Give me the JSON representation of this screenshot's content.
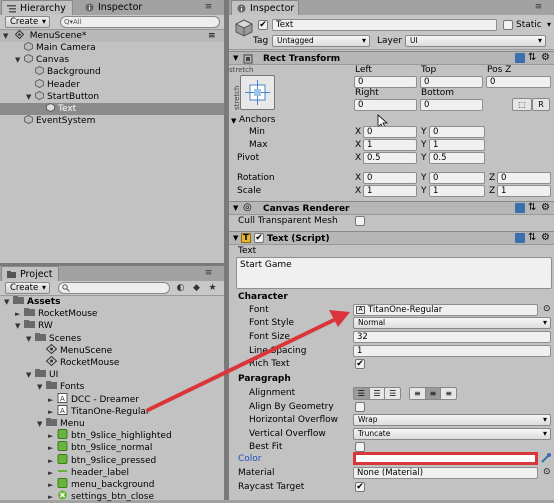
{
  "hierarchy": {
    "tabs": [
      "Hierarchy",
      "Inspector"
    ],
    "create_label": "Create",
    "search_prefix": "Q▾All",
    "scene_name": "MenuScene*",
    "items": [
      {
        "label": "Main Camera",
        "depth": 1,
        "arrow": ""
      },
      {
        "label": "Canvas",
        "depth": 1,
        "arrow": "▼"
      },
      {
        "label": "Background",
        "depth": 2,
        "arrow": ""
      },
      {
        "label": "Header",
        "depth": 2,
        "arrow": ""
      },
      {
        "label": "StartButton",
        "depth": 2,
        "arrow": "▼"
      },
      {
        "label": "Text",
        "depth": 3,
        "arrow": "",
        "selected": true
      },
      {
        "label": "EventSystem",
        "depth": 1,
        "arrow": ""
      }
    ]
  },
  "project": {
    "tab_label": "Project",
    "create_label": "Create",
    "items": [
      {
        "label": "Assets",
        "depth": 0,
        "arrow": "▼",
        "type": "folder",
        "bold": true
      },
      {
        "label": "RocketMouse",
        "depth": 1,
        "arrow": "►",
        "type": "folder"
      },
      {
        "label": "RW",
        "depth": 1,
        "arrow": "▼",
        "type": "folder"
      },
      {
        "label": "Scenes",
        "depth": 2,
        "arrow": "▼",
        "type": "folder"
      },
      {
        "label": "MenuScene",
        "depth": 3,
        "arrow": "",
        "type": "scene"
      },
      {
        "label": "RocketMouse",
        "depth": 3,
        "arrow": "",
        "type": "scene"
      },
      {
        "label": "UI",
        "depth": 2,
        "arrow": "▼",
        "type": "folder"
      },
      {
        "label": "Fonts",
        "depth": 3,
        "arrow": "▼",
        "type": "folder"
      },
      {
        "label": "DCC - Dreamer",
        "depth": 4,
        "arrow": "►",
        "type": "font"
      },
      {
        "label": "TitanOne-Regular",
        "depth": 4,
        "arrow": "►",
        "type": "font"
      },
      {
        "label": "Menu",
        "depth": 3,
        "arrow": "▼",
        "type": "folder"
      },
      {
        "label": "btn_9slice_highlighted",
        "depth": 4,
        "arrow": "►",
        "type": "sprite"
      },
      {
        "label": "btn_9slice_normal",
        "depth": 4,
        "arrow": "►",
        "type": "sprite"
      },
      {
        "label": "btn_9slice_pressed",
        "depth": 4,
        "arrow": "►",
        "type": "sprite"
      },
      {
        "label": "header_label",
        "depth": 4,
        "arrow": "►",
        "type": "sprite-dash"
      },
      {
        "label": "menu_background",
        "depth": 4,
        "arrow": "►",
        "type": "sprite"
      },
      {
        "label": "settings_btn_close",
        "depth": 4,
        "arrow": "►",
        "type": "sprite-x"
      }
    ]
  },
  "inspector": {
    "tab_label": "Inspector",
    "object_name": "Text",
    "static_label": "Static",
    "tag_label": "Tag",
    "tag_value": "Untagged",
    "layer_label": "Layer",
    "layer_value": "UI",
    "rect_transform": {
      "title": "Rect Transform",
      "stretch_label": "stretch",
      "left_label": "Left",
      "left": "0",
      "top_label": "Top",
      "top": "0",
      "posz_label": "Pos Z",
      "posz": "0",
      "right_label": "Right",
      "right": "0",
      "bottom_label": "Bottom",
      "bottom": "0",
      "r_button": "R",
      "anchors_label": "Anchors",
      "min_label": "Min",
      "min_x": "0",
      "min_y": "0",
      "max_label": "Max",
      "max_x": "1",
      "max_y": "1",
      "pivot_label": "Pivot",
      "pivot_x": "0.5",
      "pivot_y": "0.5",
      "rotation_label": "Rotation",
      "rot_x": "0",
      "rot_y": "0",
      "rot_z": "0",
      "scale_label": "Scale",
      "scale_x": "1",
      "scale_y": "1",
      "scale_z": "1",
      "x": "X",
      "y": "Y",
      "z": "Z"
    },
    "canvas_renderer": {
      "title": "Canvas Renderer",
      "cull_label": "Cull Transparent Mesh"
    },
    "text_script": {
      "title": "Text (Script)",
      "text_label": "Text",
      "text_value": "Start Game",
      "character_label": "Character",
      "font_label": "Font",
      "font_value": "TitanOne-Regular",
      "font_style_label": "Font Style",
      "font_style_value": "Normal",
      "font_size_label": "Font Size",
      "font_size_value": "32",
      "line_spacing_label": "Line Spacing",
      "line_spacing_value": "1",
      "rich_text_label": "Rich Text",
      "paragraph_label": "Paragraph",
      "alignment_label": "Alignment",
      "align_geometry_label": "Align By Geometry",
      "h_overflow_label": "Horizontal Overflow",
      "h_overflow_value": "Wrap",
      "v_overflow_label": "Vertical Overflow",
      "v_overflow_value": "Truncate",
      "best_fit_label": "Best Fit",
      "color_label": "Color",
      "material_label": "Material",
      "material_value": "None (Material)",
      "raycast_label": "Raycast Target"
    }
  },
  "colors": {
    "panel": "#c2c2c2",
    "selection": "#8a8a8a",
    "annotation_red": "#d9353b",
    "color_label_blue": "#1d4fbf"
  }
}
